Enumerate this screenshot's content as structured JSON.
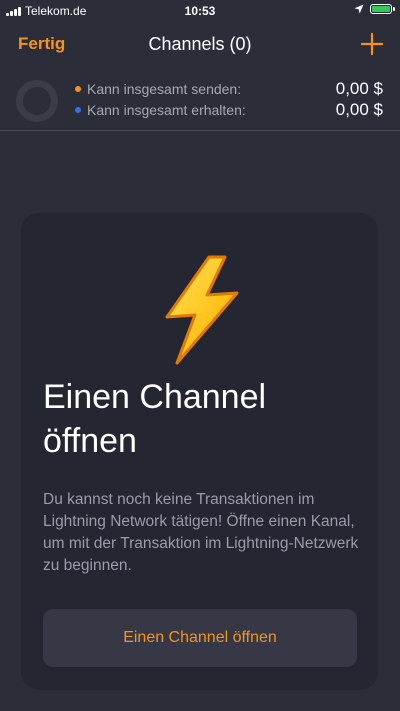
{
  "status_bar": {
    "carrier": "Telekom.de",
    "time": "10:53"
  },
  "nav": {
    "done_label": "Fertig",
    "title": "Channels (0)",
    "add_icon": "plus-icon"
  },
  "summary": {
    "send_label": "Kann insgesamt senden:",
    "send_value": "0,00 $",
    "send_color": "#f7931a",
    "receive_label": "Kann insgesamt erhalten:",
    "receive_value": "0,00 $",
    "receive_color": "#2f6ff0"
  },
  "card": {
    "icon": "lightning-icon",
    "title": "Einen Channel öffnen",
    "description": "Du kannst noch keine Transaktionen im Lightning Network tätigen! Öffne einen Kanal, um mit der Transaktion im Lightning-Netzwerk zu beginnen.",
    "button_label": "Einen Channel öffnen"
  },
  "colors": {
    "accent": "#f7931a",
    "background": "#2b2d39",
    "card": "#242631"
  }
}
